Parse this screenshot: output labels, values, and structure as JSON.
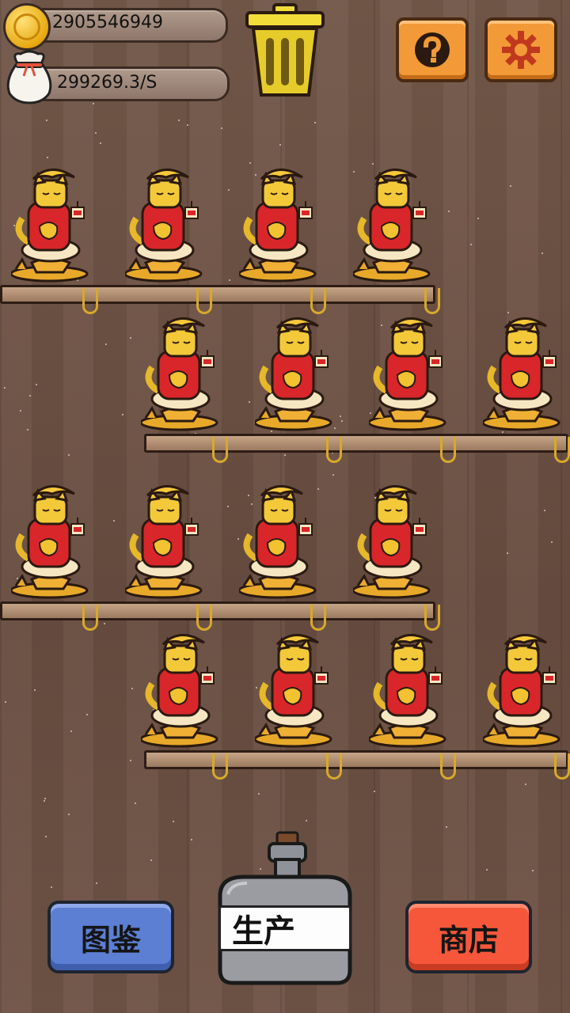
{
  "hud": {
    "coins": "2905546949",
    "rate": "299269.3/S"
  },
  "icons": {
    "coin": "gold-coin-icon",
    "bag": "money-bag-icon",
    "trash": "trash-can-icon",
    "help": "question-mark-icon",
    "settings": "gear-icon"
  },
  "shelves": [
    {
      "row": 1,
      "cats": 4
    },
    {
      "row": 2,
      "cats": 4
    },
    {
      "row": 3,
      "cats": 4
    },
    {
      "row": 4,
      "cats": 4
    }
  ],
  "buttons": {
    "collection": "图鉴",
    "produce": "生产",
    "shop": "商店"
  },
  "colors": {
    "wood": "#6e5346",
    "help_button": "#f29a37",
    "collection_button": "#5c7fd4",
    "shop_button": "#f6573a",
    "coin": "#f0b41a"
  }
}
